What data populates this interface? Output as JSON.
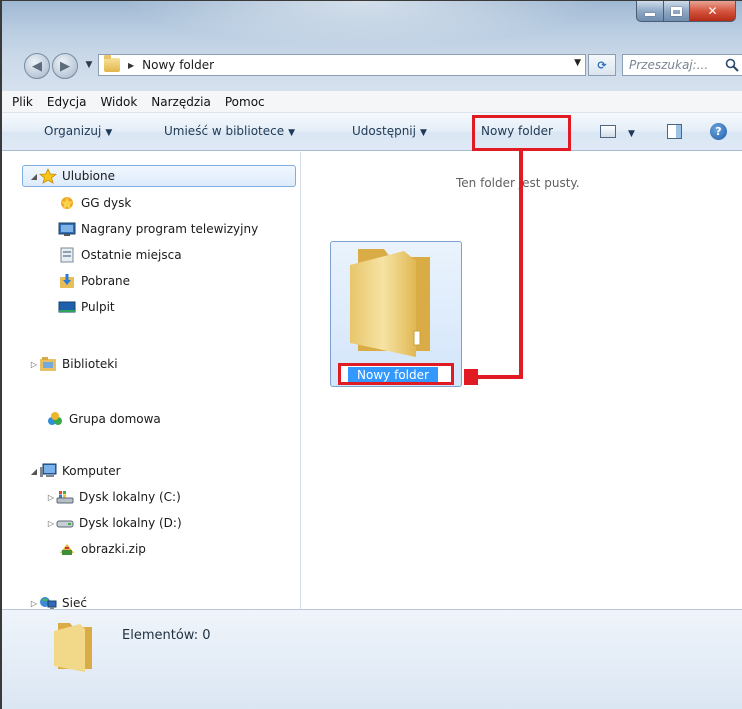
{
  "address": {
    "path_label": "Nowy folder",
    "search_placeholder": "Przeszukaj:..."
  },
  "menubar": {
    "items": [
      "Plik",
      "Edycja",
      "Widok",
      "Narzędzia",
      "Pomoc"
    ]
  },
  "toolbar": {
    "organize": "Organizuj",
    "library": "Umieść w bibliotece",
    "share": "Udostępnij",
    "new_folder": "Nowy folder"
  },
  "navpane": {
    "favorites": "Ulubione",
    "fav_items": [
      "GG dysk",
      "Nagrany program telewizyjny",
      "Ostatnie miejsca",
      "Pobrane",
      "Pulpit"
    ],
    "libraries": "Biblioteki",
    "homegroup": "Grupa domowa",
    "computer": "Komputer",
    "computer_items": [
      "Dysk lokalny (C:)",
      "Dysk lokalny (D:)",
      "obrazki.zip"
    ],
    "network": "Sieć"
  },
  "content": {
    "empty_message": "Ten folder jest pusty.",
    "new_folder_name": "Nowy folder"
  },
  "details": {
    "item_count": "Elementów: 0"
  },
  "colors": {
    "highlight": "#e01b24",
    "selection": "#3399ff"
  }
}
